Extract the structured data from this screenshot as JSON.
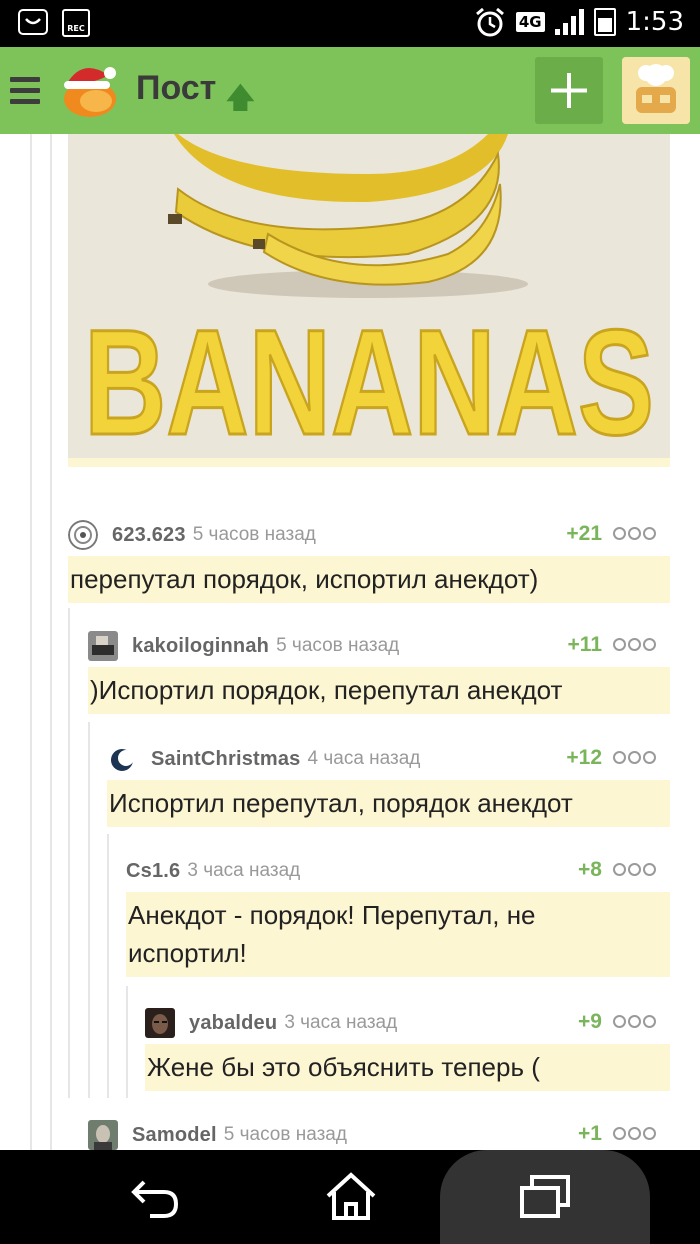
{
  "status_bar": {
    "time": "1:53",
    "network": "4G",
    "rec_label": "REC",
    "icons": [
      "shopping-bag-icon",
      "rec-icon",
      "alarm-icon",
      "network-4g-icon",
      "signal-icon",
      "battery-icon"
    ]
  },
  "app_bar": {
    "title": "Пост",
    "color": "#7ec35a",
    "icons": [
      "menu-icon",
      "pikabu-logo",
      "arrow-up-icon",
      "plus-icon",
      "profile-avatar"
    ]
  },
  "post": {
    "image_caption": "BANANAS"
  },
  "comments": [
    {
      "user": "623.623",
      "time": "5 часов назад",
      "rating": "+21",
      "text": "перепутал порядок, испортил анекдот)"
    },
    {
      "user": "kakoiloginnah",
      "time": "5 часов назад",
      "rating": "+11",
      "text": ")Испортил порядок, перепутал анекдот"
    },
    {
      "user": "SaintChristmas",
      "time": "4 часа назад",
      "rating": "+12",
      "text": "Испортил перепутал, порядок анекдот"
    },
    {
      "user": "Cs1.6",
      "time": "3 часа назад",
      "rating": "+8",
      "text": "Анекдот - порядок! Перепутал, не испортил!"
    },
    {
      "user": "yabaldeu",
      "time": "3 часа назад",
      "rating": "+9",
      "text": "Жене бы это объяснить теперь ("
    },
    {
      "user": "Samodel",
      "time": "5 часов назад",
      "rating": "+1",
      "text": ""
    }
  ],
  "colors": {
    "accent_green": "#7ec35a",
    "rating_green": "#7ab55c",
    "comment_bg": "#fdf6d3"
  },
  "nav_bar": {
    "icons": [
      "back-icon",
      "home-icon",
      "recents-icon"
    ]
  }
}
